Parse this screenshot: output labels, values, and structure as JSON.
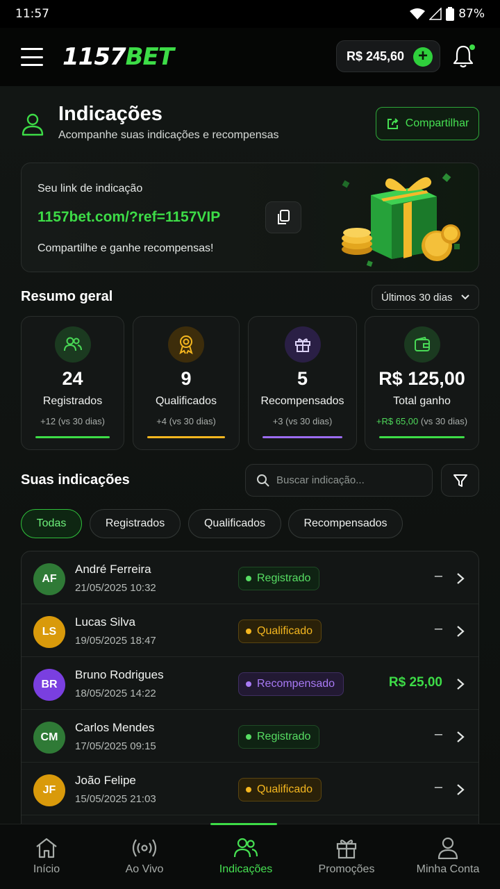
{
  "status": {
    "time": "11:57",
    "battery": "87%"
  },
  "header": {
    "logo_num": "1157",
    "logo_bet": "BET",
    "balance": "R$ 245,60",
    "balance_plus": "+"
  },
  "page": {
    "title": "Indicações",
    "subtitle": "Acompanhe suas indicações e recompensas",
    "share_label": "Compartilhar"
  },
  "referral": {
    "label": "Seu link de indicação",
    "link": "1157bet.com/?ref=1157VIP",
    "note": "Compartilhe e ganhe recompensas!"
  },
  "summary": {
    "title": "Resumo geral",
    "period": "Últimos 30 dias",
    "stats": [
      {
        "value": "24",
        "label": "Registrados",
        "change": "+12 (vs 30 dias)",
        "color": "#3ddc47",
        "icon": "users-icon"
      },
      {
        "value": "9",
        "label": "Qualificados",
        "change": "+4 (vs 30 dias)",
        "color": "#f5b71f",
        "icon": "award-icon"
      },
      {
        "value": "5",
        "label": "Recompensados",
        "change": "+3 (vs 30 dias)",
        "color": "#9b6cf0",
        "icon": "gift-icon"
      },
      {
        "value": "R$ 125,00",
        "label": "Total ganho",
        "change_pos": "+R$ 65,00",
        "change_rest": " (vs 30 dias)",
        "color": "#3ddc47",
        "icon": "wallet-icon"
      }
    ]
  },
  "list": {
    "title": "Suas indicações",
    "search_placeholder": "Buscar indicação...",
    "filters": [
      "Todas",
      "Registrados",
      "Qualificados",
      "Recompensados"
    ],
    "active_filter": "Todas",
    "rows": [
      {
        "initials": "AF",
        "name": "André Ferreira",
        "date": "21/05/2025 10:32",
        "status": "Registrado",
        "amount": "–",
        "avatar_color": "#2f7a36"
      },
      {
        "initials": "LS",
        "name": "Lucas Silva",
        "date": "19/05/2025 18:47",
        "status": "Qualificado",
        "amount": "–",
        "avatar_color": "#d99a0b"
      },
      {
        "initials": "BR",
        "name": "Bruno Rodrigues",
        "date": "18/05/2025 14:22",
        "status": "Recompensado",
        "amount": "R$ 25,00",
        "avatar_color": "#7a3fe0"
      },
      {
        "initials": "CM",
        "name": "Carlos Mendes",
        "date": "17/05/2025 09:15",
        "status": "Registrado",
        "amount": "–",
        "avatar_color": "#2f7a36"
      },
      {
        "initials": "JF",
        "name": "João Felipe",
        "date": "15/05/2025 21:03",
        "status": "Qualificado",
        "amount": "–",
        "avatar_color": "#d99a0b"
      }
    ]
  },
  "nav": {
    "items": [
      {
        "label": "Início",
        "icon": "home-icon"
      },
      {
        "label": "Ao Vivo",
        "icon": "live-icon"
      },
      {
        "label": "Indicações",
        "icon": "referrals-icon"
      },
      {
        "label": "Promoções",
        "icon": "gift-icon"
      },
      {
        "label": "Minha Conta",
        "icon": "account-icon"
      }
    ],
    "active": "Indicações"
  }
}
